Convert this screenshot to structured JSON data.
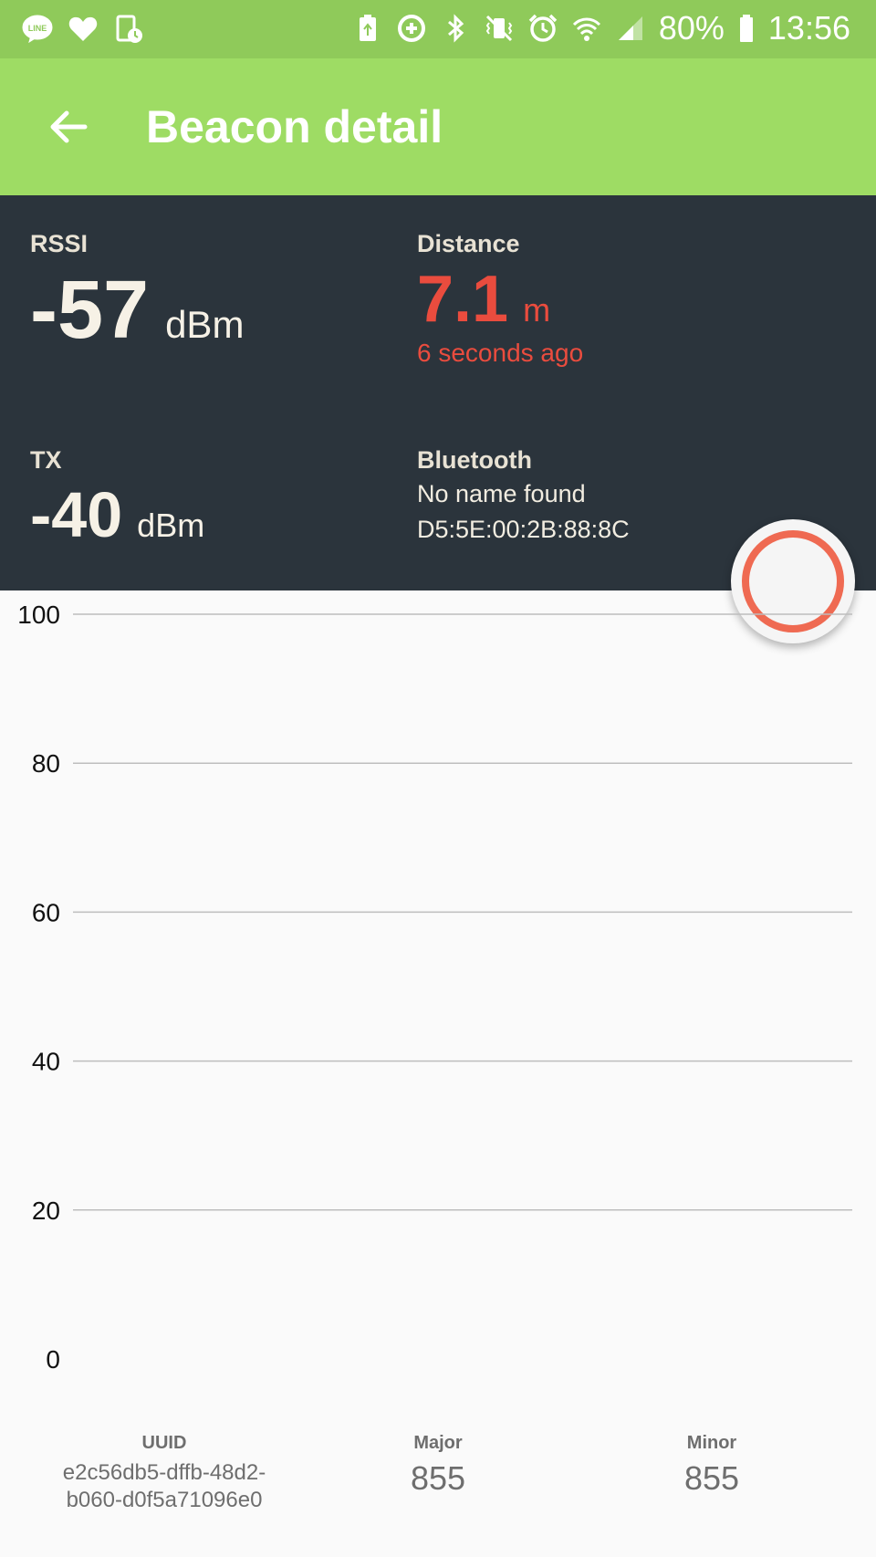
{
  "status_bar": {
    "left_icons": [
      "line-app-icon",
      "heart-icon",
      "screen-timer-icon"
    ],
    "right_icons": [
      "battery-saver-icon",
      "data-saver-icon",
      "bluetooth-icon",
      "vibrate-icon",
      "alarm-icon",
      "wifi-icon",
      "signal-icon"
    ],
    "battery_percent": "80%",
    "time": "13:56"
  },
  "app_bar": {
    "title": "Beacon detail",
    "back_icon": "arrow-back-icon"
  },
  "rssi": {
    "label": "RSSI",
    "value": "-57",
    "unit": "dBm"
  },
  "distance": {
    "label": "Distance",
    "value": "7.1",
    "unit": "m",
    "updated": "6 seconds ago"
  },
  "tx": {
    "label": "TX",
    "value": "-40",
    "unit": "dBm"
  },
  "bluetooth": {
    "label": "Bluetooth",
    "name": "No name found",
    "address": "D5:5E:00:2B:88:8C"
  },
  "colors": {
    "status_bar": "#8fca5a",
    "app_bar": "#9edc64",
    "panel": "#2b343c",
    "accent_red": "#ea4c3e",
    "fab_ring": "#ef6a52"
  },
  "chart_data": {
    "type": "line",
    "title": "",
    "xlabel": "",
    "ylabel": "",
    "ylim": [
      0,
      100
    ],
    "yticks": [
      100,
      80,
      60,
      40,
      20,
      0
    ],
    "grid": true,
    "series": []
  },
  "beacon": {
    "uuid_label": "UUID",
    "uuid_line1": "e2c56db5-dffb-48d2-",
    "uuid_line2": "b060-d0f5a71096e0",
    "major_label": "Major",
    "major": "855",
    "minor_label": "Minor",
    "minor": "855"
  }
}
